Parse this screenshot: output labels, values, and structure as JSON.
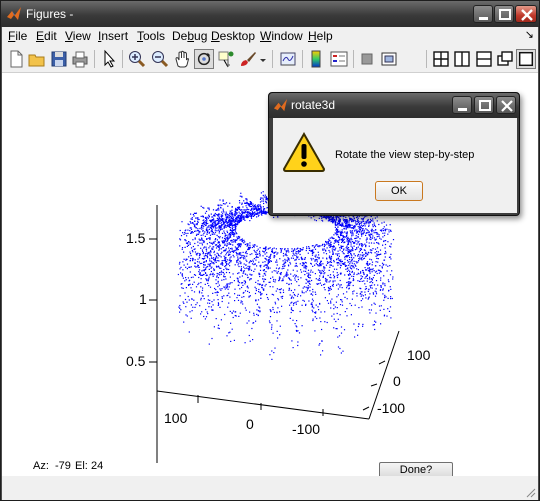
{
  "window": {
    "title": "Figures -"
  },
  "menu": {
    "items": [
      {
        "label": "File",
        "mnemonic": "F",
        "rest": "ile"
      },
      {
        "label": "Edit",
        "mnemonic": "E",
        "rest": "dit"
      },
      {
        "label": "View",
        "mnemonic": "V",
        "rest": "iew"
      },
      {
        "label": "Insert",
        "mnemonic": "I",
        "rest": "nsert"
      },
      {
        "label": "Tools",
        "mnemonic": "T",
        "rest": "ools"
      },
      {
        "label": "Debug",
        "mnemonic": "b",
        "rest": "Debug"
      },
      {
        "label": "Desktop",
        "mnemonic": "D",
        "rest": "esktop"
      },
      {
        "label": "Window",
        "mnemonic": "W",
        "rest": "indow"
      },
      {
        "label": "Help",
        "mnemonic": "H",
        "rest": "elp"
      }
    ],
    "overflow_arrow": "↘"
  },
  "toolbar": {
    "icons": [
      "new-figure",
      "open-file",
      "save",
      "print",
      "edit-plot",
      "zoom-in",
      "zoom-out",
      "pan",
      "rotate-3d",
      "data-cursor",
      "brush",
      "link-plot",
      "colorbar",
      "legend",
      "hide-plot-tools",
      "show-plot-tools",
      "tile",
      "split-vertical",
      "split-horizontal",
      "float",
      "dock"
    ]
  },
  "plot": {
    "z_ticks": [
      "1.5",
      "1",
      "0.5"
    ],
    "x_ticks": [
      "100",
      "0",
      "-100"
    ],
    "y_ticks": [
      "100",
      "0",
      "-100"
    ],
    "view": {
      "az": -79,
      "el": 24
    },
    "marker_color": "#0000ff"
  },
  "status": {
    "az_label": "Az:",
    "az_value": "-79",
    "el_label": "El:",
    "el_value": "24"
  },
  "done_button": "Done?",
  "dialog": {
    "title": "rotate3d",
    "message": "Rotate the view step-by-step",
    "ok": "OK",
    "icon": "warning-icon"
  }
}
